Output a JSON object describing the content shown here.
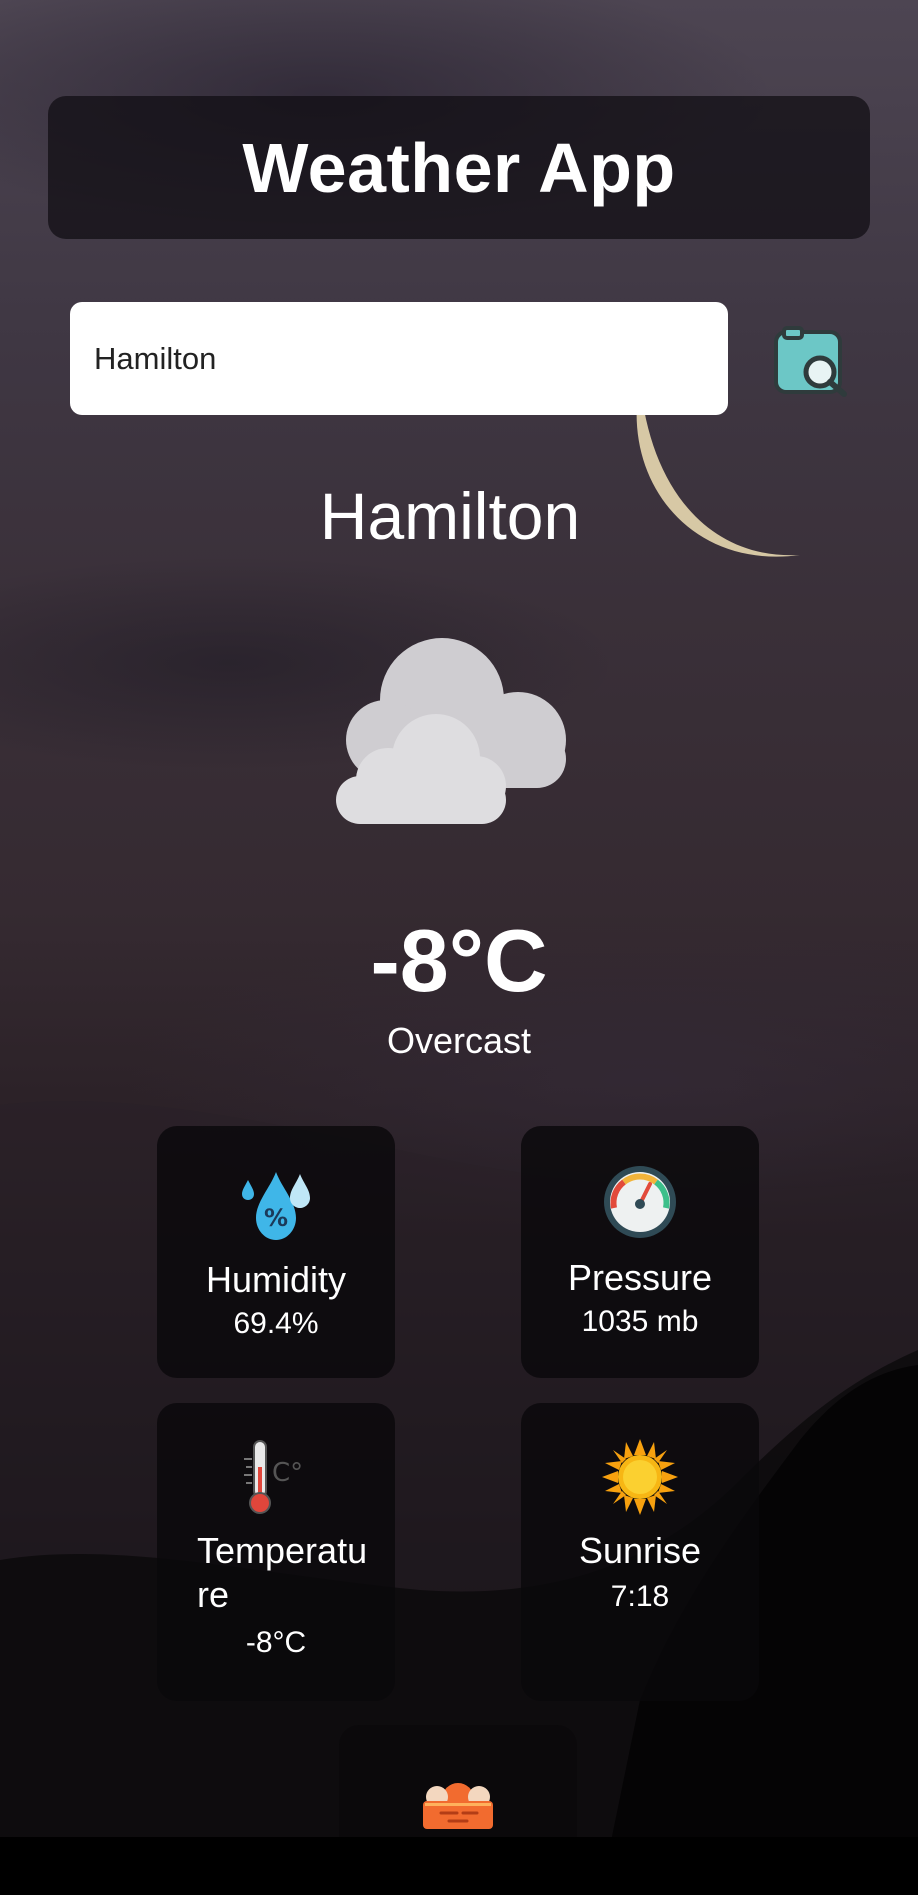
{
  "app": {
    "title": "Weather App"
  },
  "search": {
    "value": "Hamilton",
    "placeholder": ""
  },
  "current": {
    "city": "Hamilton",
    "temperature": "-8°C",
    "condition": "Overcast",
    "icon": "cloudy-icon"
  },
  "cards": {
    "humidity": {
      "label": "Humidity",
      "value": "69.4%",
      "icon": "humidity-icon"
    },
    "pressure": {
      "label": "Pressure",
      "value": "1035 mb",
      "icon": "pressure-gauge-icon"
    },
    "temperature": {
      "label": "Temperature",
      "value": "-8°C",
      "icon": "thermometer-icon",
      "icon_text": "C°"
    },
    "sunrise": {
      "label": "Sunrise",
      "value": "7:18",
      "icon": "sun-icon"
    },
    "sunset": {
      "icon": "sunset-icon"
    }
  },
  "colors": {
    "search_button": "#6cc7c6",
    "cloud": "#d4d3d6",
    "sun": "#f7b614"
  }
}
